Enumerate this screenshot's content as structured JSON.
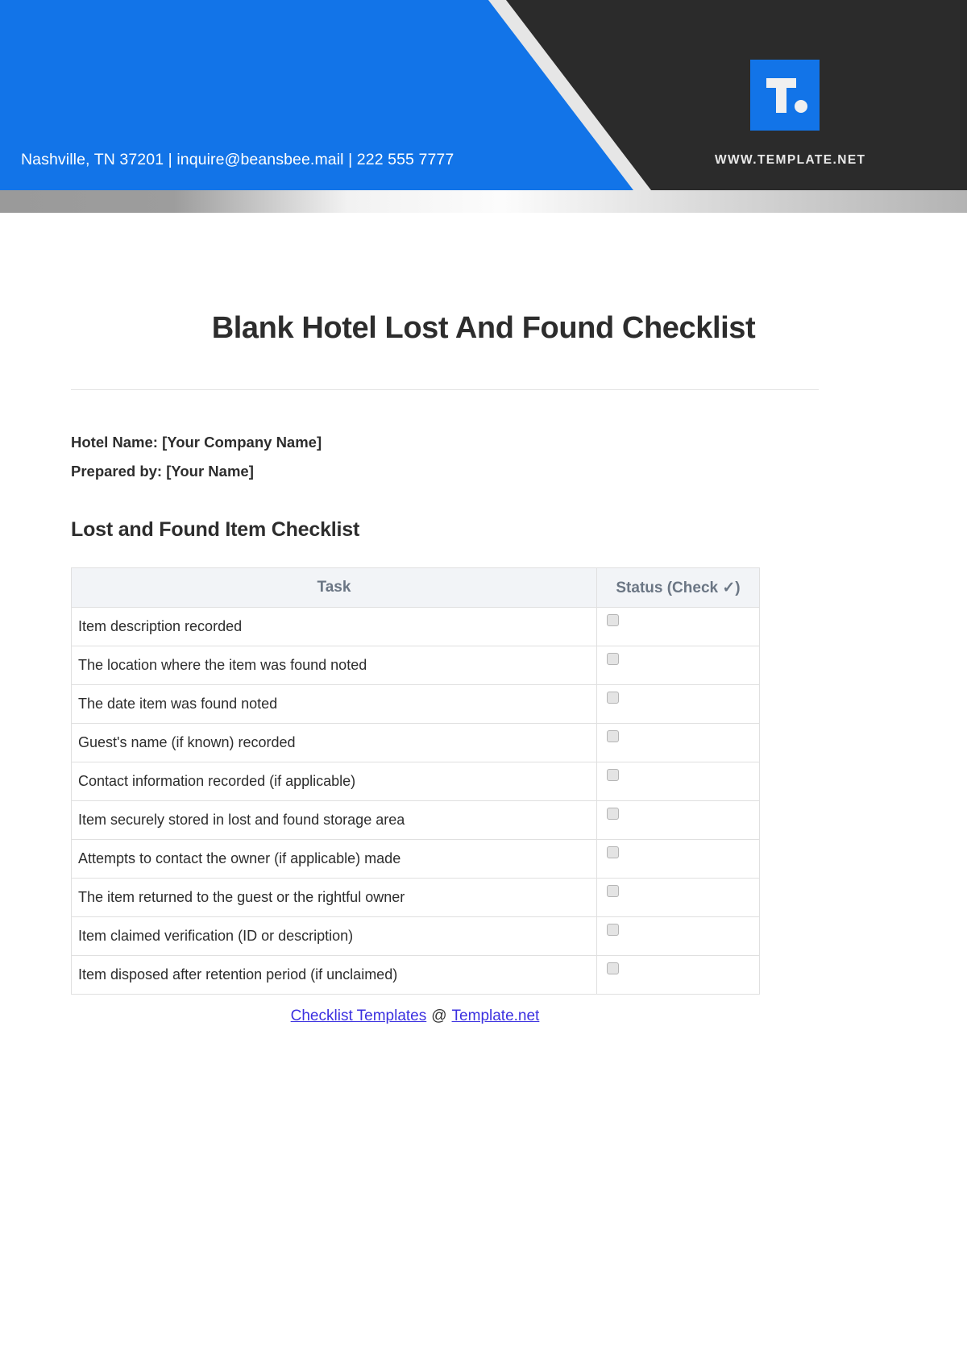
{
  "header": {
    "contact": "Nashville, TN 37201 | inquire@beansbee.mail | 222 555 7777",
    "website": "WWW.TEMPLATE.NET",
    "logo_letter": "T.",
    "brand_blue": "#1274e8",
    "bar_dark": "#2b2b2b"
  },
  "document": {
    "title": "Blank Hotel Lost And Found Checklist",
    "meta": [
      "Hotel Name: [Your Company Name]",
      "Prepared by: [Your Name]"
    ],
    "section_heading": "Lost and Found Item Checklist"
  },
  "table": {
    "columns": [
      "Task",
      "Status (Check ✓)"
    ],
    "rows": [
      "Item description recorded",
      "The location where the item was found noted",
      "The date item was found noted",
      "Guest's name (if known) recorded",
      "Contact information recorded (if applicable)",
      "Item securely stored in lost and found storage area",
      "Attempts to contact the owner (if applicable) made",
      "The item returned to the guest or the rightful owner",
      "Item claimed verification (ID or description)",
      "Item disposed after retention period (if unclaimed)"
    ]
  },
  "footer": {
    "link_primary": "Checklist Templates",
    "separator": "@",
    "link_secondary": "Template.net",
    "link_color": "#3b30e0"
  }
}
